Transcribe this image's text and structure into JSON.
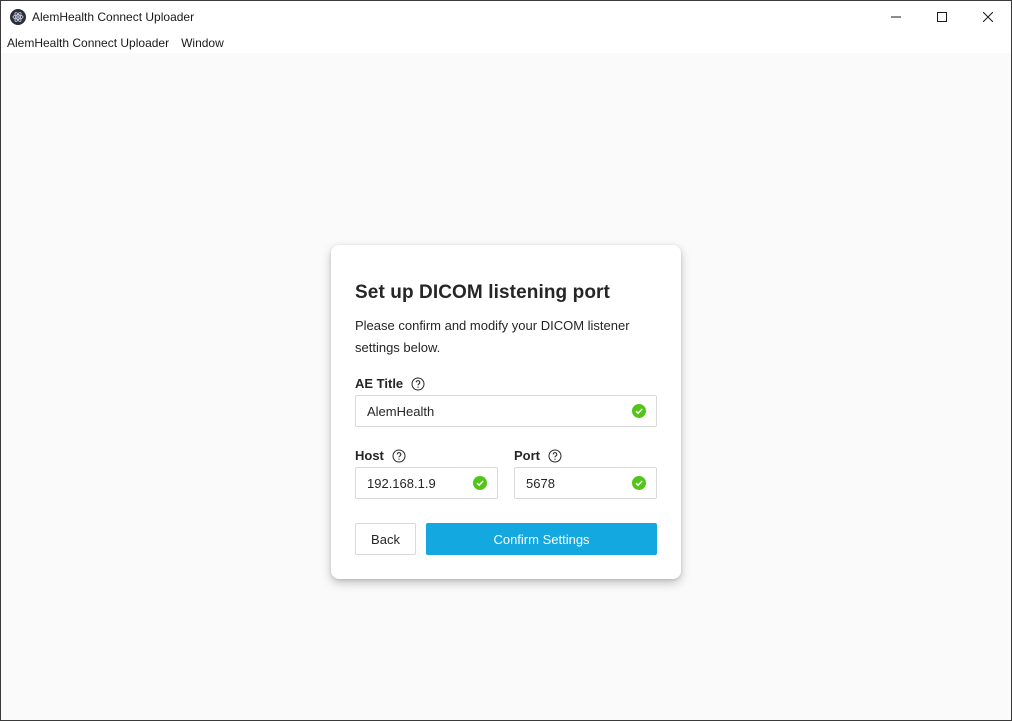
{
  "window": {
    "title": "AlemHealth Connect Uploader",
    "icon": "atom-icon"
  },
  "menu": {
    "items": [
      {
        "label": "AlemHealth Connect Uploader"
      },
      {
        "label": "Window"
      }
    ]
  },
  "dialog": {
    "title": "Set up DICOM listening port",
    "description": "Please confirm and modify your DICOM listener settings below.",
    "ae_title": {
      "label": "AE Title",
      "value": "AlemHealth"
    },
    "host": {
      "label": "Host",
      "value": "192.168.1.9"
    },
    "port": {
      "label": "Port",
      "value": "5678"
    },
    "back_label": "Back",
    "confirm_label": "Confirm Settings"
  },
  "colors": {
    "accent": "#13a8e0",
    "success": "#52c41a",
    "background": "#fafafa"
  }
}
